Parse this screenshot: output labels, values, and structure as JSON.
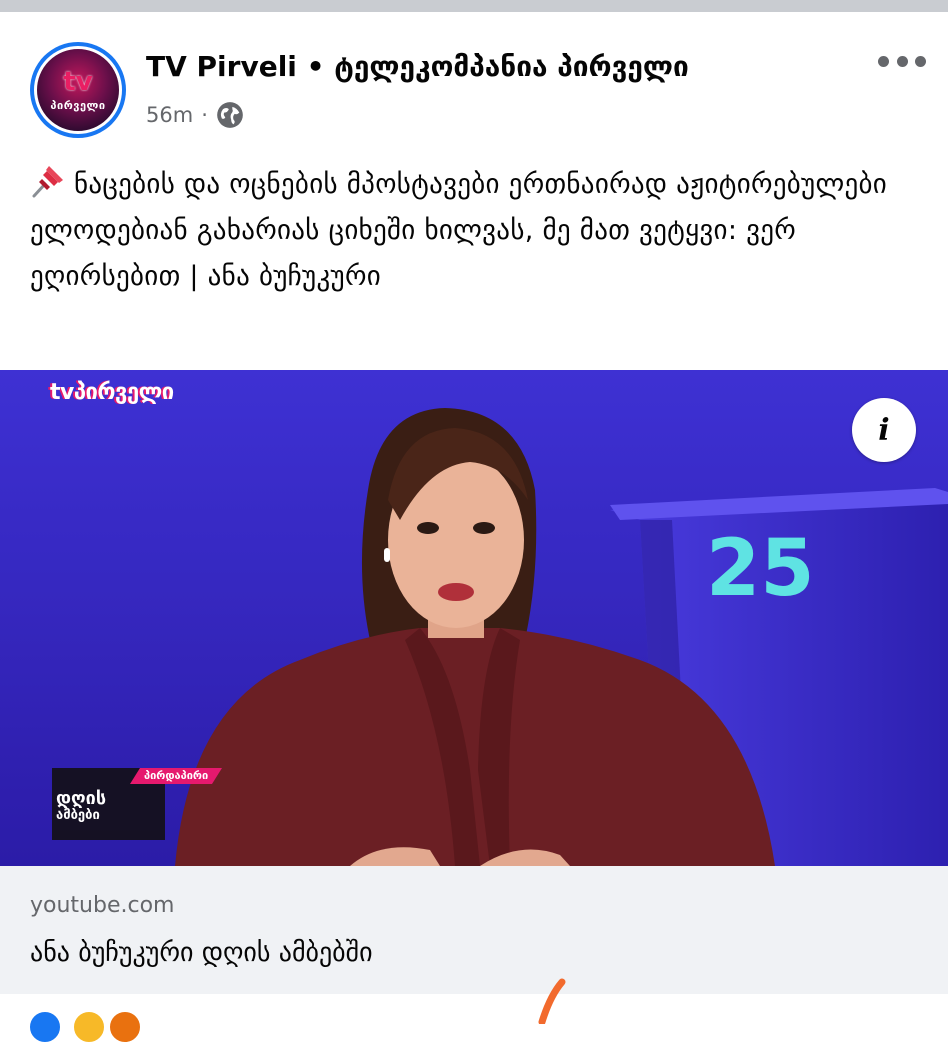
{
  "post": {
    "page_name": "TV Pirveli • ტელეკომპანია პირველი",
    "timestamp": "56m",
    "separator": "·",
    "privacy_icon": "globe-icon",
    "more_icon": "more-horizontal-icon",
    "pin_icon": "pushpin-icon",
    "text": "ნაცების და ოცნების მპოსტავები ერთნაირად აჟიტირებულები ელოდებიან გახარიას ციხეში ხილვას, მე მათ ვეტყვი: ვერ ეღირსებით | ანა ბუჩუკური",
    "avatar": {
      "logo_text": "tv",
      "logo_word": "პირველი"
    }
  },
  "video": {
    "channel_logo": "tvპირველი",
    "program_badge": "პირდაპირი",
    "program_logo_line1": "დღის",
    "program_logo_line2": "ამბები",
    "podium_number": "25",
    "info_icon": "info-icon",
    "info_label": "i"
  },
  "link": {
    "domain": "youtube.com",
    "title": "ანა ბუჩუკური დღის ამბებში"
  },
  "colors": {
    "brand_blue": "#1877f2",
    "secondary_text": "#65676b",
    "link_bg": "#f0f2f5",
    "studio_purple": "#3024b6",
    "podium_cyan": "#5fe3e3"
  }
}
